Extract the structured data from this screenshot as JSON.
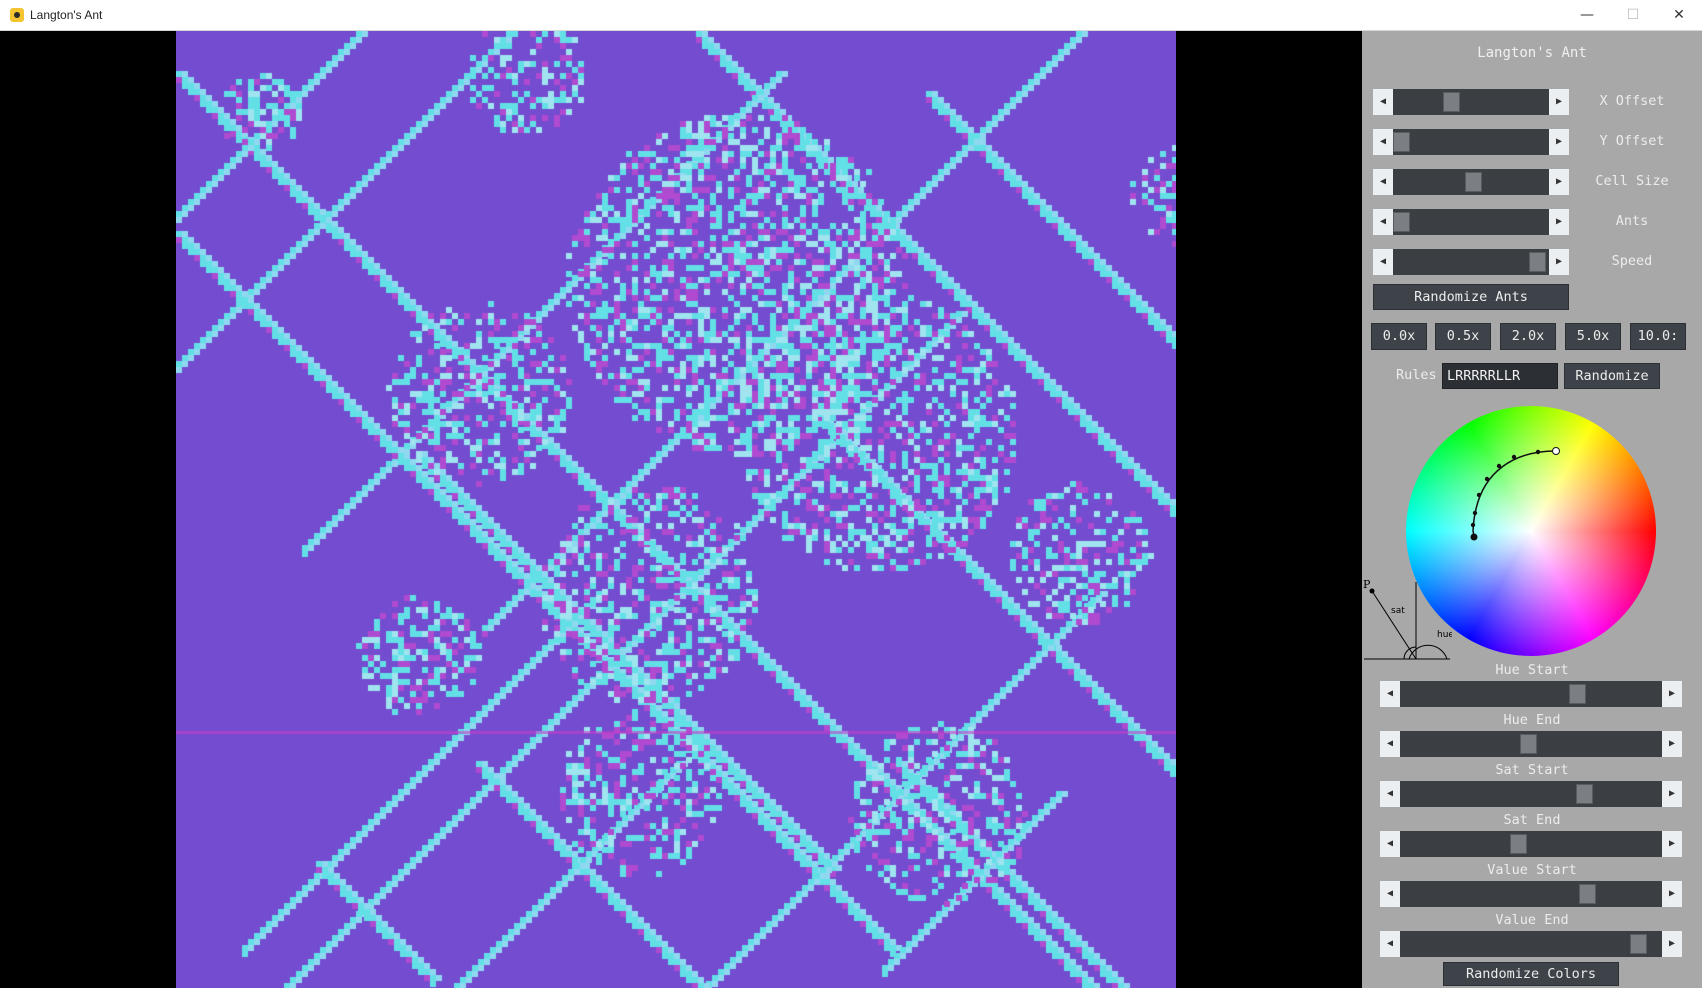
{
  "window": {
    "title": "Langton's Ant",
    "minimize": "—",
    "maximize": "☐",
    "close": "✕"
  },
  "panel": {
    "title": "Langton's Ant",
    "sliders": [
      {
        "label": "X Offset",
        "value": 0.36
      },
      {
        "label": "Y Offset",
        "value": 0.0
      },
      {
        "label": "Cell Size",
        "value": 0.52
      },
      {
        "label": "Ants",
        "value": 0.0
      },
      {
        "label": "Speed",
        "value": 0.98
      }
    ],
    "randomize_ants": "Randomize Ants",
    "speed_buttons": [
      "0.0x",
      "0.5x",
      "2.0x",
      "5.0x",
      "10.0:"
    ],
    "rules_label": "Rules",
    "rules_value": "LRRRRRLLR",
    "randomize_rules": "Randomize",
    "hsv_labels": {
      "p": "P",
      "sat": "sat",
      "hue": "hue"
    },
    "color_sliders": [
      {
        "label": "Hue Start",
        "value": 0.69
      },
      {
        "label": "Hue End",
        "value": 0.49
      },
      {
        "label": "Sat Start",
        "value": 0.72
      },
      {
        "label": "Sat End",
        "value": 0.45
      },
      {
        "label": "Value Start",
        "value": 0.73
      },
      {
        "label": "Value End",
        "value": 0.94
      }
    ],
    "randomize_colors": "Randomize Colors"
  },
  "colors": {
    "background_cell": "#744ccf",
    "trail_cyan": "#62e0e6",
    "trail_magenta": "#b04ad0",
    "panel_bg": "#a8a8a8"
  },
  "icons": {
    "app": "ant-icon"
  }
}
